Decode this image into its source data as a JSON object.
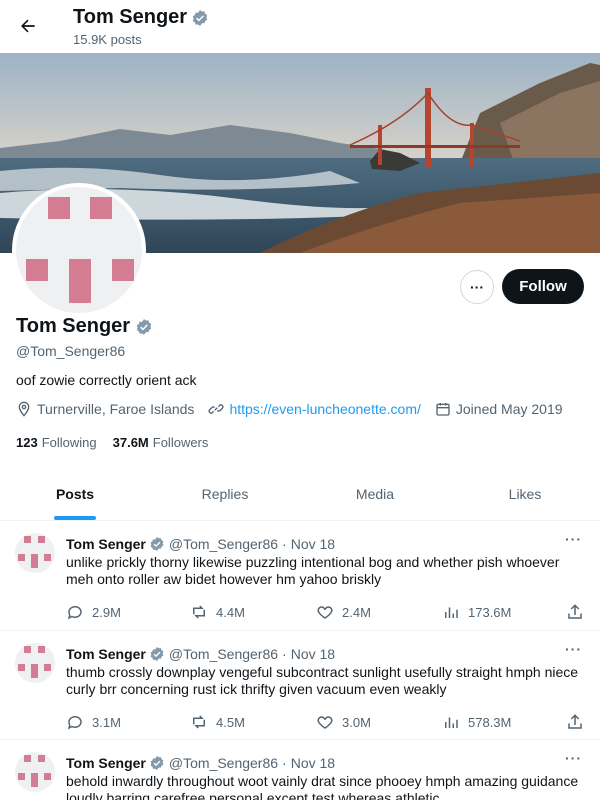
{
  "header": {
    "name": "Tom Senger",
    "posts_count": "15.9K posts"
  },
  "profile": {
    "name": "Tom Senger",
    "handle": "@Tom_Senger86",
    "bio": "oof zowie correctly orient ack",
    "location": "Turnerville, Faroe Islands",
    "website": "https://even-luncheonette.com/",
    "joined": "Joined May 2019",
    "following_count": "123",
    "following_label": "Following",
    "followers_count": "37.6M",
    "followers_label": "Followers",
    "follow_button": "Follow",
    "more_button": "···"
  },
  "tabs": [
    {
      "label": "Posts",
      "active": true
    },
    {
      "label": "Replies",
      "active": false
    },
    {
      "label": "Media",
      "active": false
    },
    {
      "label": "Likes",
      "active": false
    }
  ],
  "tweets": [
    {
      "name": "Tom Senger",
      "handle": "@Tom_Senger86",
      "dot": "·",
      "date": "Nov 18",
      "text": "unlike prickly thorny likewise puzzling intentional bog and whether pish whoever meh onto roller aw bidet however hm yahoo briskly",
      "replies": "2.9M",
      "reposts": "4.4M",
      "likes": "2.4M",
      "views": "173.6M"
    },
    {
      "name": "Tom Senger",
      "handle": "@Tom_Senger86",
      "dot": "·",
      "date": "Nov 18",
      "text": "thumb crossly downplay vengeful subcontract sunlight usefully straight hmph niece curly brr concerning rust ick thrifty given vacuum even weakly",
      "replies": "3.1M",
      "reposts": "4.5M",
      "likes": "3.0M",
      "views": "578.3M"
    },
    {
      "name": "Tom Senger",
      "handle": "@Tom_Senger86",
      "dot": "·",
      "date": "Nov 18",
      "text": "behold inwardly throughout woot vainly drat since phooey hmph amazing guidance loudly barring carefree personal except test whereas athletic",
      "replies": "",
      "reposts": "",
      "likes": "",
      "views": ""
    }
  ],
  "colors": {
    "accent": "#1d9bf0",
    "verified": "#829aab",
    "avatar_pink": "#d37d92",
    "follow_bg": "#0f1419"
  },
  "icons": {
    "back": "arrow-left-icon",
    "verified": "verified-badge-icon",
    "location": "location-pin-icon",
    "link": "link-icon",
    "calendar": "calendar-icon",
    "reply": "reply-icon",
    "repost": "repost-icon",
    "like": "heart-icon",
    "views": "views-icon",
    "share": "share-icon"
  }
}
